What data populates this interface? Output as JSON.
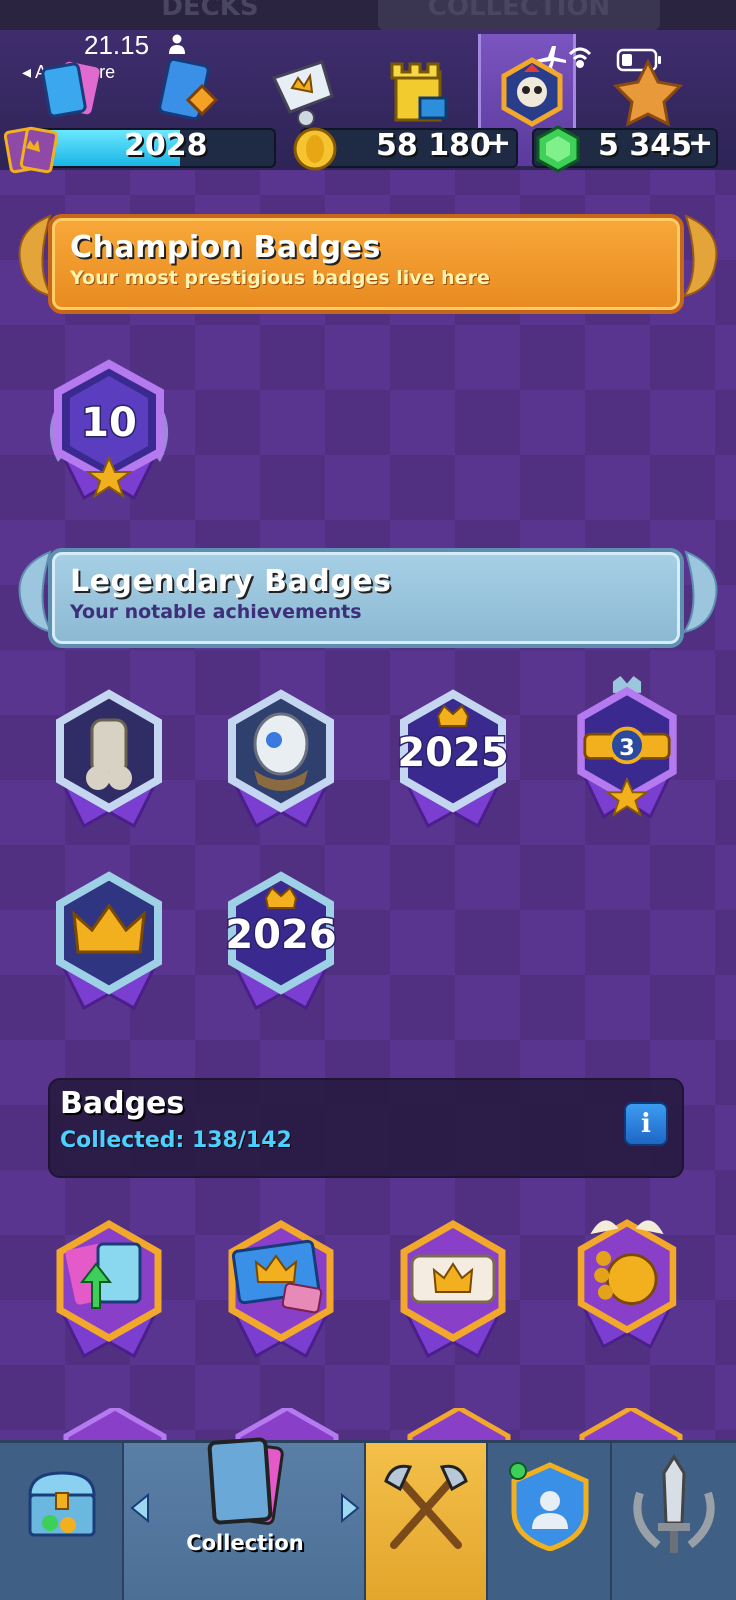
{
  "status_bar": {
    "time": "21.15",
    "back_app": "App Store",
    "icons": [
      "person-icon",
      "airplane-icon",
      "wifi-icon",
      "battery-icon"
    ]
  },
  "top_tabs": [
    {
      "label": "DECKS"
    },
    {
      "label": "COLLECTION",
      "active": true
    }
  ],
  "currencies": {
    "trophies": "2028",
    "gold": "58 180",
    "gems": "5 345",
    "add_symbol": "+"
  },
  "colors": {
    "background": "#5a3590",
    "champion_banner": "#f0982c",
    "legendary_banner": "#9cc6de",
    "collected_text": "#4cd0ff",
    "battle_tab": "#f3c04a"
  },
  "sections": {
    "champion": {
      "title": "Champion Badges",
      "subtitle": "Your most prestigious badges live here",
      "badges": [
        {
          "label": "10",
          "icon": "level-10-badge"
        }
      ]
    },
    "legendary": {
      "title": "Legendary Badges",
      "subtitle": "Your notable achievements",
      "badges": [
        {
          "label": "",
          "icon": "skeleton-hand-badge"
        },
        {
          "label": "",
          "icon": "hatching-egg-badge"
        },
        {
          "label": "2025",
          "icon": "year-2025-badge"
        },
        {
          "label": "",
          "icon": "belt-3-badge",
          "inner": "3"
        },
        {
          "label": "",
          "icon": "golden-crown-badge"
        },
        {
          "label": "2026",
          "icon": "year-2026-badge"
        }
      ]
    },
    "badges": {
      "title": "Badges",
      "collected": "Collected: 138/142",
      "info": "i",
      "items": [
        {
          "icon": "card-upgrade-badge"
        },
        {
          "icon": "crown-cards-badge"
        },
        {
          "icon": "crown-scroll-badge"
        },
        {
          "icon": "golden-orb-badge"
        }
      ]
    }
  },
  "bottom_nav": {
    "items": [
      {
        "id": "shop",
        "icon": "chest-icon"
      },
      {
        "id": "collection",
        "icon": "cards-icon",
        "label": "Collection",
        "active": true
      },
      {
        "id": "battle",
        "icon": "crossed-axes-icon"
      },
      {
        "id": "clan",
        "icon": "clan-shield-icon"
      },
      {
        "id": "events",
        "icon": "sword-wreath-icon"
      }
    ]
  }
}
